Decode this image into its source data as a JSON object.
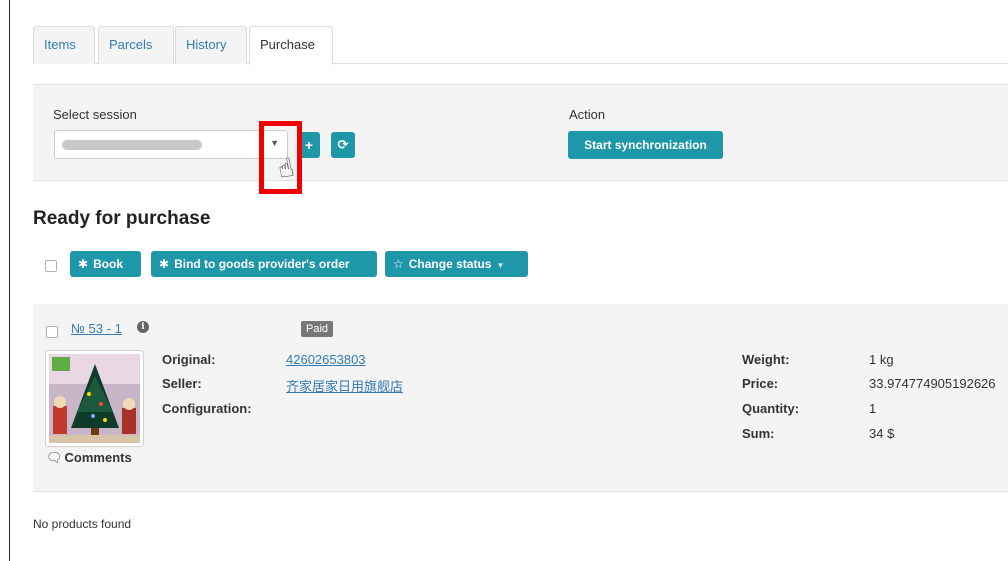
{
  "tabs": [
    {
      "label": "Items",
      "active": false
    },
    {
      "label": "Parcels",
      "active": false
    },
    {
      "label": "History",
      "active": false
    },
    {
      "label": "Purchase",
      "active": true
    }
  ],
  "session": {
    "select_label": "Select session",
    "action_label": "Action",
    "sync_button": "Start synchronization",
    "add_icon": "plus-icon",
    "refresh_icon": "refresh-icon",
    "highlight_color": "#f20000"
  },
  "section": {
    "title": "Ready for purchase",
    "toolbar": {
      "book": "Book",
      "bind": "Bind to goods provider's order",
      "change_status": "Change status"
    }
  },
  "order": {
    "number": "№ 53 - 1",
    "status": "Paid",
    "comments": "Comments",
    "fields_left": [
      {
        "key": "Original:",
        "value": "42602653803",
        "link": true
      },
      {
        "key": "Seller:",
        "value": "齐家居家日用旗舰店",
        "link": true
      },
      {
        "key": "Configuration:",
        "value": "",
        "link": false
      }
    ],
    "fields_right": [
      {
        "key": "Weight:",
        "value": "1 kg"
      },
      {
        "key": "Price:",
        "value": "33.974774905192626"
      },
      {
        "key": "Quantity:",
        "value": "1"
      },
      {
        "key": "Sum:",
        "value": "34 $"
      }
    ]
  },
  "empty_message": "No products found",
  "colors": {
    "accent": "#1e97a8",
    "link": "#337ab7",
    "badge": "#777777",
    "panel": "#f4f4f4"
  }
}
